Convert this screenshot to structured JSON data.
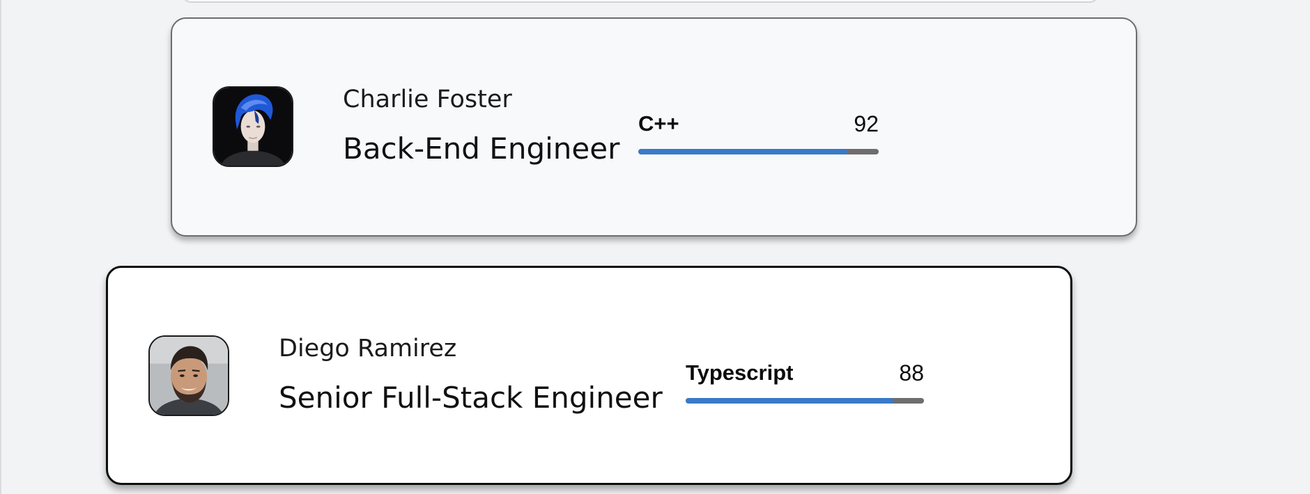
{
  "cards": [
    {
      "name": "Charlie Foster",
      "role": "Back-End Engineer",
      "skill": {
        "label": "C++",
        "score": "92",
        "level": 0.87
      }
    },
    {
      "name": "Diego Ramirez",
      "role": "Senior Full-Stack Engineer",
      "skill": {
        "label": "Typescript",
        "score": "88",
        "level": 0.87
      }
    }
  ],
  "colors": {
    "bar_fill": "#3a7ac8",
    "bar_track": "#6e6e6e"
  }
}
